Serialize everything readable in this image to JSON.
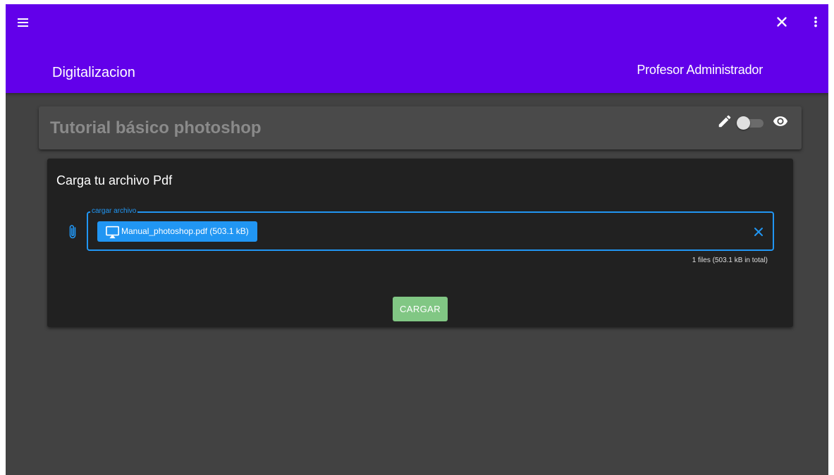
{
  "toolbar": {
    "app_title": "Digitalizacion",
    "user_name": "Profesor Administrador",
    "background_color": "#6200ea",
    "icons": {
      "menu": "menu-icon",
      "close": "close-icon",
      "more": "more-vert-icon"
    }
  },
  "document": {
    "title": "Tutorial básico photoshop",
    "icons": {
      "edit": "pencil-icon",
      "visibility": "eye-icon"
    },
    "toggle": {
      "checked": false
    }
  },
  "upload": {
    "heading": "Carga tu archivo Pdf",
    "field_label": "cargar archivo",
    "chip_label": "Manual_photoshop.pdf (503.1 kB)",
    "summary": "1 files (503.1 kB in total)",
    "submit_label": "CARGAR",
    "accent_color": "#2196f3",
    "submit_color": "#81c784",
    "icons": {
      "attach": "paperclip-icon",
      "chip": "cast-icon",
      "clear": "close-icon"
    }
  }
}
